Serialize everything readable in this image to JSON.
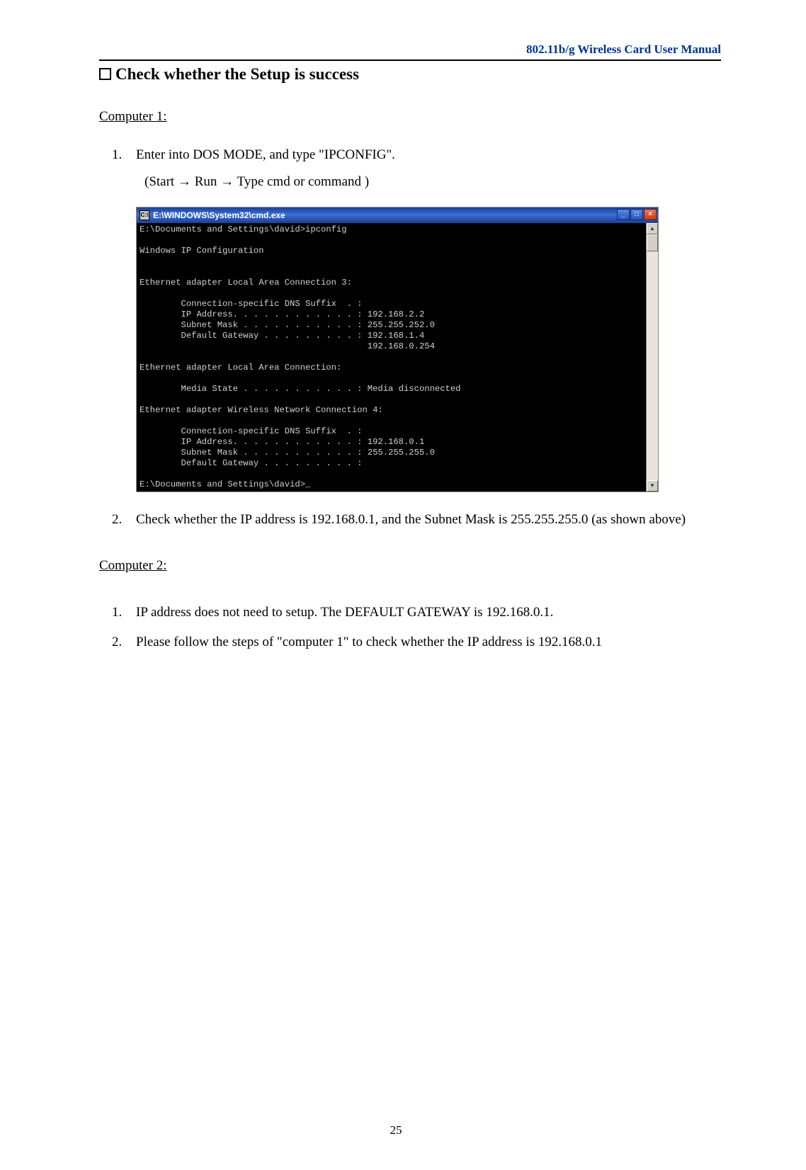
{
  "header": {
    "title": "802.11b/g Wireless Card User Manual"
  },
  "section": {
    "title": "Check whether the Setup is success"
  },
  "comp1": {
    "heading": "Computer 1:",
    "items": [
      {
        "num": "1.",
        "text": "Enter into DOS MODE, and type \"IPCONFIG\".",
        "subtext": "(Start → Run → Type cmd or command )"
      },
      {
        "num": "2.",
        "text": "Check whether the IP address is 192.168.0.1, and the Subnet Mask is 255.255.255.0 (as shown above)"
      }
    ]
  },
  "cmd": {
    "title_icon": "C:\\",
    "title": "E:\\WINDOWS\\System32\\cmd.exe",
    "min": "_",
    "max": "□",
    "close": "×",
    "scroll_up": "▲",
    "scroll_down": "▼",
    "body": "E:\\Documents and Settings\\david>ipconfig\n\nWindows IP Configuration\n\n\nEthernet adapter Local Area Connection 3:\n\n        Connection-specific DNS Suffix  . :\n        IP Address. . . . . . . . . . . . : 192.168.2.2\n        Subnet Mask . . . . . . . . . . . : 255.255.252.0\n        Default Gateway . . . . . . . . . : 192.168.1.4\n                                            192.168.0.254\n\nEthernet adapter Local Area Connection:\n\n        Media State . . . . . . . . . . . : Media disconnected\n\nEthernet adapter Wireless Network Connection 4:\n\n        Connection-specific DNS Suffix  . :\n        IP Address. . . . . . . . . . . . : 192.168.0.1\n        Subnet Mask . . . . . . . . . . . : 255.255.255.0\n        Default Gateway . . . . . . . . . :\n\nE:\\Documents and Settings\\david>_"
  },
  "comp2": {
    "heading": "Computer 2:",
    "items": [
      {
        "num": "1.",
        "text": "IP address does not need to setup. The DEFAULT GATEWAY is 192.168.0.1."
      },
      {
        "num": "2.",
        "text": "Please follow the steps of \"computer 1\" to check whether the IP address is 192.168.0.1"
      }
    ]
  },
  "page_number": "25"
}
